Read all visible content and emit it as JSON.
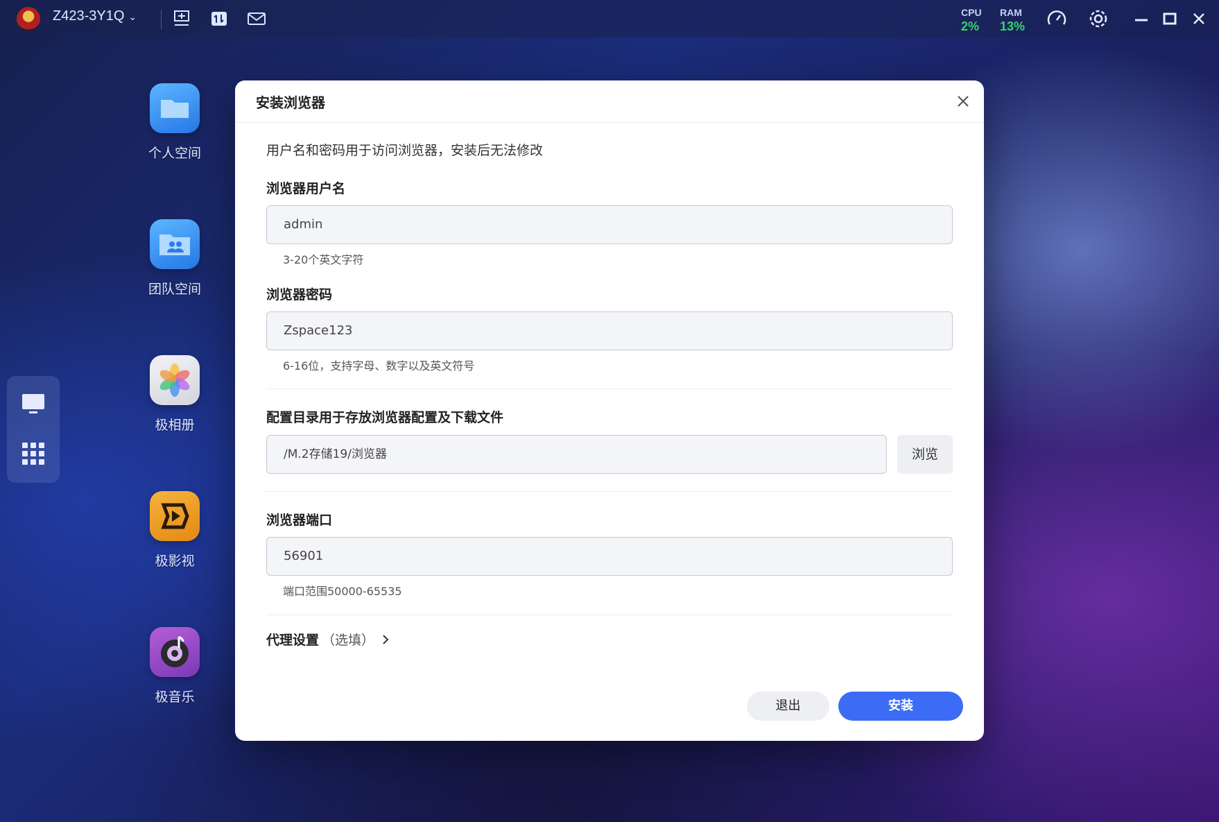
{
  "topbar": {
    "device_name": "Z423-3Y1Q",
    "cpu_label": "CPU",
    "cpu_value": "2%",
    "ram_label": "RAM",
    "ram_value": "13%",
    "stat_color": "#37d26a"
  },
  "desktop": {
    "apps": [
      {
        "name": "个人空间",
        "icon": "folder-icon"
      },
      {
        "name": "团队空间",
        "icon": "team-folder-icon"
      },
      {
        "name": "极相册",
        "icon": "photos-icon"
      },
      {
        "name": "极影视",
        "icon": "video-icon"
      },
      {
        "name": "极音乐",
        "icon": "music-icon"
      }
    ]
  },
  "dialog": {
    "title": "安装浏览器",
    "note": "用户名和密码用于访问浏览器，安装后无法修改",
    "username": {
      "label": "浏览器用户名",
      "value": "admin",
      "hint": "3-20个英文字符"
    },
    "password": {
      "label": "浏览器密码",
      "value": "Zspace123",
      "hint": "6-16位，支持字母、数字以及英文符号"
    },
    "config_dir": {
      "label": "配置目录用于存放浏览器配置及下载文件",
      "value": "/M.2存储19/浏览器",
      "browse_label": "浏览"
    },
    "port": {
      "label": "浏览器端口",
      "value": "56901",
      "hint": "端口范围50000-65535"
    },
    "proxy": {
      "label": "代理设置",
      "optional": "（选填）"
    },
    "cancel_label": "退出",
    "install_label": "安装",
    "accent_color": "#3c6cf5"
  }
}
